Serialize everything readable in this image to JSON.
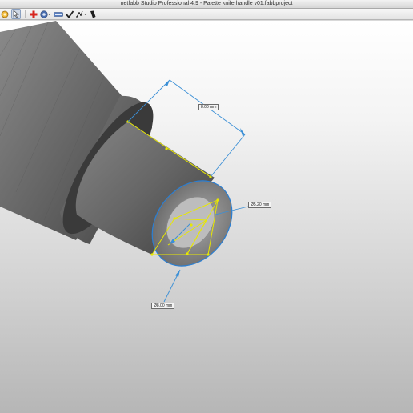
{
  "window": {
    "title": "netfabb Studio Professional 4.9 - Palette knife handle v01.fabbproject"
  },
  "toolbar": {
    "icons": [
      "open-icon",
      "pointer-icon",
      "add-part-icon",
      "settings-icon",
      "key-icon",
      "check-icon",
      "measure-icon",
      "paint-icon"
    ]
  },
  "measurements": {
    "length": "8.00 mm",
    "inner_diameter": "Ø5.20 mm",
    "outer_diameter": "Ø8.00 mm"
  },
  "colors": {
    "accent": "#1e88e5",
    "measure_line": "#e8e800",
    "dimension_line": "#3a8fd6",
    "model": "#6d6d6d"
  }
}
